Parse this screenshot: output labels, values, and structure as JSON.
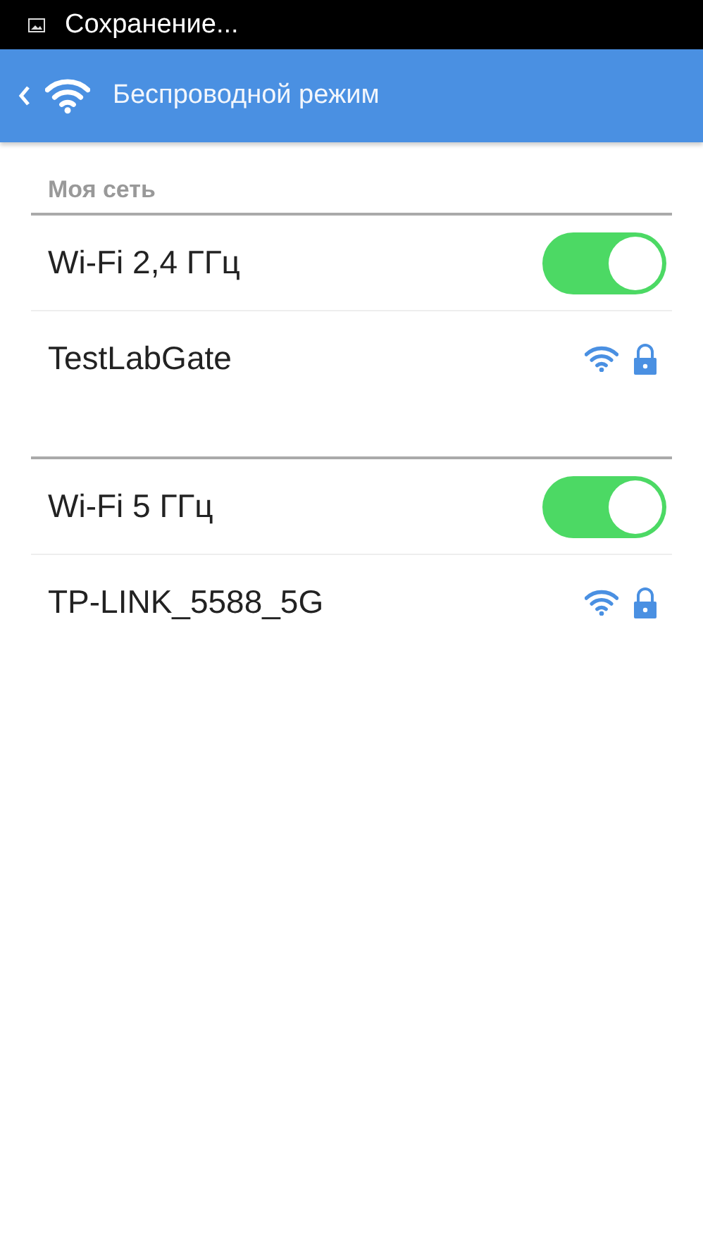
{
  "status_bar": {
    "text": "Сохранение..."
  },
  "app_bar": {
    "title": "Беспроводной режим"
  },
  "sections": [
    {
      "header": "Моя сеть",
      "band": {
        "label": "Wi-Fi 2,4 ГГц",
        "on": true
      },
      "network": {
        "name": "TestLabGate",
        "locked": true
      }
    },
    {
      "band": {
        "label": "Wi-Fi 5 ГГц",
        "on": true
      },
      "network": {
        "name": "TP-LINK_5588_5G",
        "locked": true
      }
    }
  ]
}
